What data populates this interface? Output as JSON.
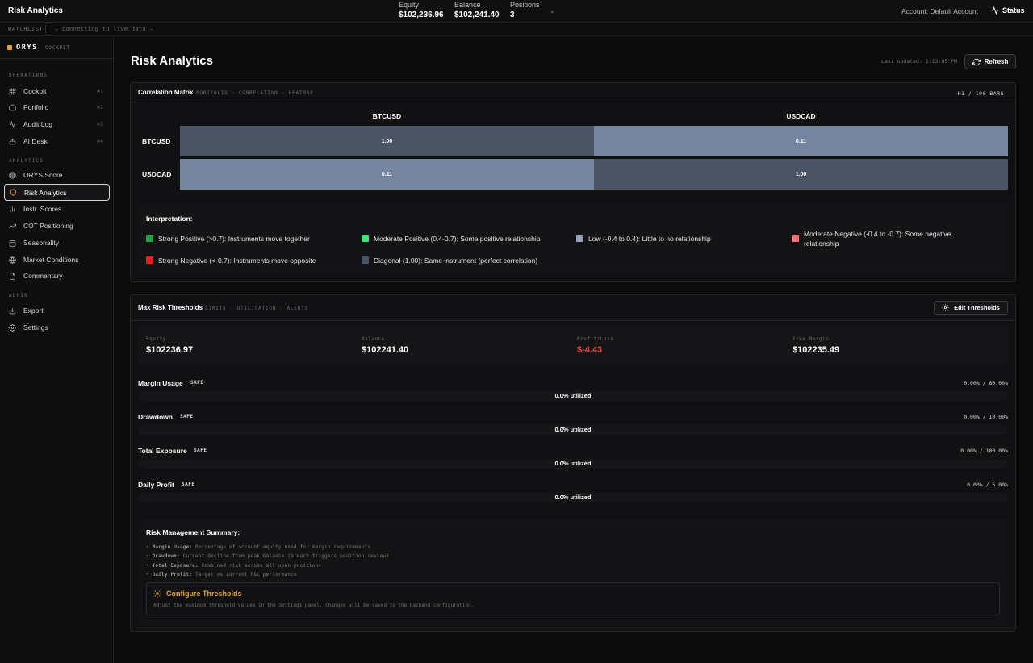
{
  "app": {
    "title": "Risk Analytics"
  },
  "topbar": {
    "equity_label": "Equity",
    "equity_value": "$102,236.96",
    "balance_label": "Balance",
    "balance_value": "$102,241.40",
    "positions_label": "Positions",
    "positions_value": "3",
    "account_text": "Account:  Default Account",
    "status_label": "Status"
  },
  "watchlist": {
    "label": "WATCHLIST",
    "status": "— connecting to live data —"
  },
  "sidebar": {
    "brand_name": "ORYS",
    "brand_sub": "COCKPIT",
    "sections": {
      "operations": "OPERATIONS",
      "analytics": "ANALYTICS",
      "admin": "ADMIN"
    },
    "items": [
      {
        "label": "Cockpit",
        "shortcut": "⌘1",
        "icon": "grid-icon"
      },
      {
        "label": "Portfolio",
        "shortcut": "⌘2",
        "icon": "briefcase-icon"
      },
      {
        "label": "Audit Log",
        "shortcut": "⌘3",
        "icon": "activity-icon"
      },
      {
        "label": "AI Desk",
        "shortcut": "⌘4",
        "icon": "bot-icon"
      },
      {
        "label": "ORYS Score",
        "icon": "target-icon"
      },
      {
        "label": "Risk Analytics",
        "icon": "shield-icon",
        "active": true
      },
      {
        "label": "Instr. Scores",
        "icon": "bar-chart-icon"
      },
      {
        "label": "COT Positioning",
        "icon": "trending-up-icon"
      },
      {
        "label": "Seasonality",
        "icon": "calendar-icon"
      },
      {
        "label": "Market Conditions",
        "icon": "globe-icon"
      },
      {
        "label": "Commentary",
        "icon": "file-text-icon"
      },
      {
        "label": "Export",
        "icon": "download-icon"
      },
      {
        "label": "Settings",
        "icon": "gear-icon"
      }
    ]
  },
  "page": {
    "title": "Risk Analytics",
    "last_updated": "Last updated: 1:13:05 PM",
    "refresh_label": "Refresh"
  },
  "correlation": {
    "title": "Correlation Matrix",
    "subtitle": "PORTFOLIO · CORRELATION · HEATMAP",
    "right_label": "H1 / 100 BARS",
    "instruments": [
      "BTCUSD",
      "USDCAD"
    ],
    "matrix": [
      [
        "1.00",
        "0.11"
      ],
      [
        "0.11",
        "1.00"
      ]
    ],
    "interpretation_title": "Interpretation:",
    "legend": [
      {
        "color": "#22a04b",
        "text": "Strong Positive (>0.7): Instruments move together"
      },
      {
        "color": "#4ade80",
        "text": "Moderate Positive (0.4-0.7): Some positive relationship"
      },
      {
        "color": "#94a3b8",
        "text": "Low (-0.4 to 0.4): Little to no relationship"
      },
      {
        "color": "#f87171",
        "text": "Moderate Negative (-0.4 to -0.7): Some negative relationship"
      },
      {
        "color": "#dc2626",
        "text": "Strong Negative (<-0.7): Instruments move opposite"
      },
      {
        "color": "#475569",
        "text": "Diagonal (1.00): Same instrument (perfect correlation)"
      }
    ]
  },
  "risk": {
    "title": "Max Risk Thresholds",
    "subtitle": "LIMITS · UTILISATION · ALERTS",
    "edit_label": "Edit Thresholds",
    "stats": [
      {
        "label": "Equity",
        "value": "$102236.97"
      },
      {
        "label": "Balance",
        "value": "$102241.40"
      },
      {
        "label": "Profit/Loss",
        "value": "$-4.43",
        "negative": true
      },
      {
        "label": "Free Margin",
        "value": "$102235.49"
      }
    ],
    "limits": [
      {
        "name": "Margin Usage",
        "badge": "SAFE",
        "range": "0.00% / 80.00%",
        "utilized": "0.0% utilized",
        "fraction": 0
      },
      {
        "name": "Drawdown",
        "badge": "SAFE",
        "range": "0.00% / 10.00%",
        "utilized": "0.0% utilized",
        "fraction": 0
      },
      {
        "name": "Total Exposure",
        "badge": "SAFE",
        "range": "0.00% / 100.00%",
        "utilized": "0.0% utilized",
        "fraction": 0
      },
      {
        "name": "Daily Profit",
        "badge": "SAFE",
        "range": "0.00% / 5.00%",
        "utilized": "0.0% utilized",
        "fraction": 0
      }
    ],
    "summary": {
      "title": "Risk Management Summary:",
      "lines": [
        {
          "term": "Margin Usage:",
          "text": "Percentage of account equity used for margin requirements"
        },
        {
          "term": "Drawdown:",
          "text": "Current decline from peak balance (breach triggers position review)"
        },
        {
          "term": "Total Exposure:",
          "text": "Combined risk across all open positions"
        },
        {
          "term": "Daily Profit:",
          "text": "Target vs current P&L performance"
        }
      ],
      "configure_title": "Configure Thresholds",
      "configure_desc": "Adjust the maximum threshold values in the Settings panel. Changes will be saved to the backend configuration."
    }
  },
  "colors": {
    "accent": "#e8a526",
    "negative": "#e84a4a",
    "diag_cell": "#4a5464",
    "low_cell": "#7585a0"
  }
}
